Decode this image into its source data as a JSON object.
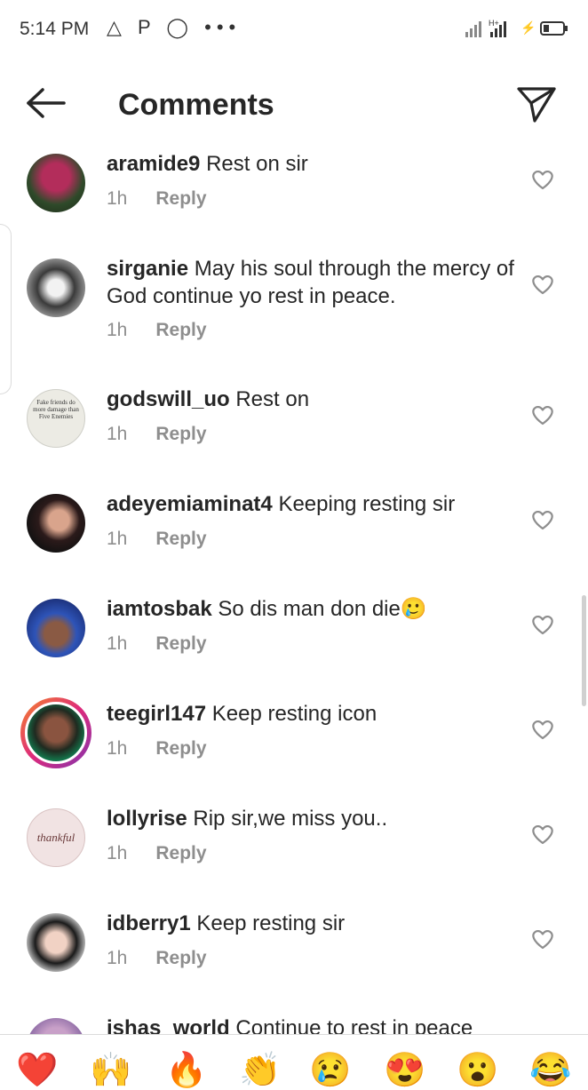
{
  "status_bar": {
    "time": "5:14 PM",
    "notif_icons": "△ P ◯ •••",
    "network": "H+",
    "battery": "⚡"
  },
  "header": {
    "title": "Comments"
  },
  "comments": [
    {
      "user": "aramide9",
      "text": "Rest on sir",
      "time": "1h",
      "reply": "Reply"
    },
    {
      "user": "sirganie",
      "text": "May his soul through the mercy of God continue yo rest in peace.",
      "time": "1h",
      "reply": "Reply"
    },
    {
      "user": "godswill_uo",
      "text": "Rest on",
      "time": "1h",
      "reply": "Reply",
      "avatar_text": "Fake friends do more damage than Five Enemies"
    },
    {
      "user": "adeyemiaminat4",
      "text": "Keeping resting sir",
      "time": "1h",
      "reply": "Reply"
    },
    {
      "user": "iamtosbak",
      "text": "So dis man don die🥲",
      "time": "1h",
      "reply": "Reply"
    },
    {
      "user": "teegirl147",
      "text": "Keep resting icon",
      "time": "1h",
      "reply": "Reply"
    },
    {
      "user": "lollyrise",
      "text": "Rip sir,we miss you..",
      "time": "1h",
      "reply": "Reply",
      "avatar_text": "thankful"
    },
    {
      "user": "idberry1",
      "text": "Keep resting sir",
      "time": "1h",
      "reply": "Reply"
    },
    {
      "user": "ishas_world",
      "text": "Continue to rest in peace",
      "time": "",
      "reply": ""
    }
  ],
  "reactions": [
    "❤️",
    "🙌",
    "🔥",
    "👏",
    "😢",
    "😍",
    "😮",
    "😂"
  ]
}
